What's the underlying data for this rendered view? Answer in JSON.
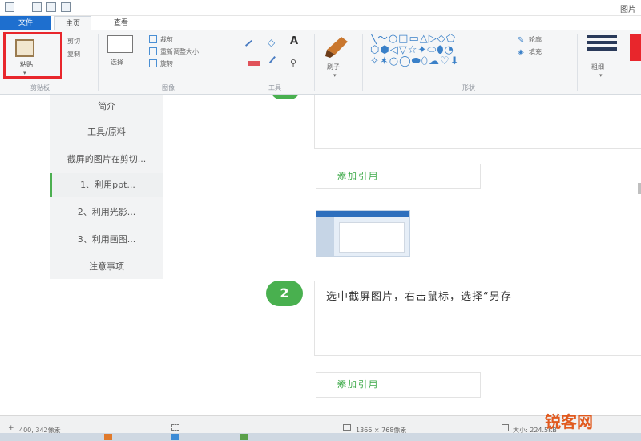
{
  "app": {
    "title": "图片"
  },
  "tabs": {
    "file": "文件",
    "home": "主页",
    "view": "查看"
  },
  "ribbon": {
    "clipboard": {
      "paste": "粘贴",
      "cut": "剪切",
      "copy": "复制",
      "group": "剪贴板"
    },
    "image": {
      "select": "选择",
      "crop": "裁剪",
      "resize": "重新调整大小",
      "rotate": "旋转",
      "group": "图像"
    },
    "tools": {
      "group": "工具"
    },
    "brushes": {
      "label": "刷子"
    },
    "shapes": {
      "outline": "轮廓",
      "fill": "填充",
      "group": "形状"
    },
    "size": {
      "label": "粗细"
    }
  },
  "toc": {
    "items": [
      "简介",
      "工具/原料",
      "截屏的图片在剪切...",
      "1、利用ppt...",
      "2、利用光影...",
      "3、利用画图...",
      "注意事项"
    ]
  },
  "content": {
    "add_reference_1": "添加引用",
    "add_reference_2": "添加引用",
    "step_number": "2",
    "step_text": "选中截屏图片，右击鼠标，选择“另存"
  },
  "status": {
    "position": "400, 342像素",
    "dimensions": "1366 × 768像素",
    "file_size": "大小: 224.5KB"
  },
  "watermark": "锐客网",
  "colors": {
    "accent": "#1e6fcf",
    "highlight": "#e8262c",
    "step_green": "#49b04f",
    "link_green": "#39a845"
  }
}
